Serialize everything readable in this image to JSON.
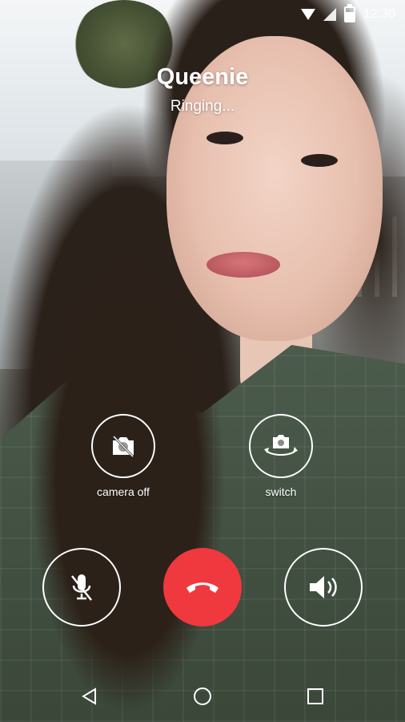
{
  "status_bar": {
    "time": "12:30",
    "icons": [
      "wifi-icon",
      "signal-icon",
      "battery-icon"
    ]
  },
  "call": {
    "caller_name": "Queenie",
    "call_status": "Ringing..."
  },
  "controls": {
    "camera_off_label": "camera off",
    "switch_label": "switch",
    "icons": [
      "camera-off-icon",
      "switch-camera-icon",
      "mute-mic-icon",
      "end-call-icon",
      "speaker-icon"
    ]
  },
  "colors": {
    "end_call": "#f0383f",
    "text": "#ffffff"
  },
  "navigation": {
    "icons": [
      "back-icon",
      "home-icon",
      "recents-icon"
    ]
  }
}
